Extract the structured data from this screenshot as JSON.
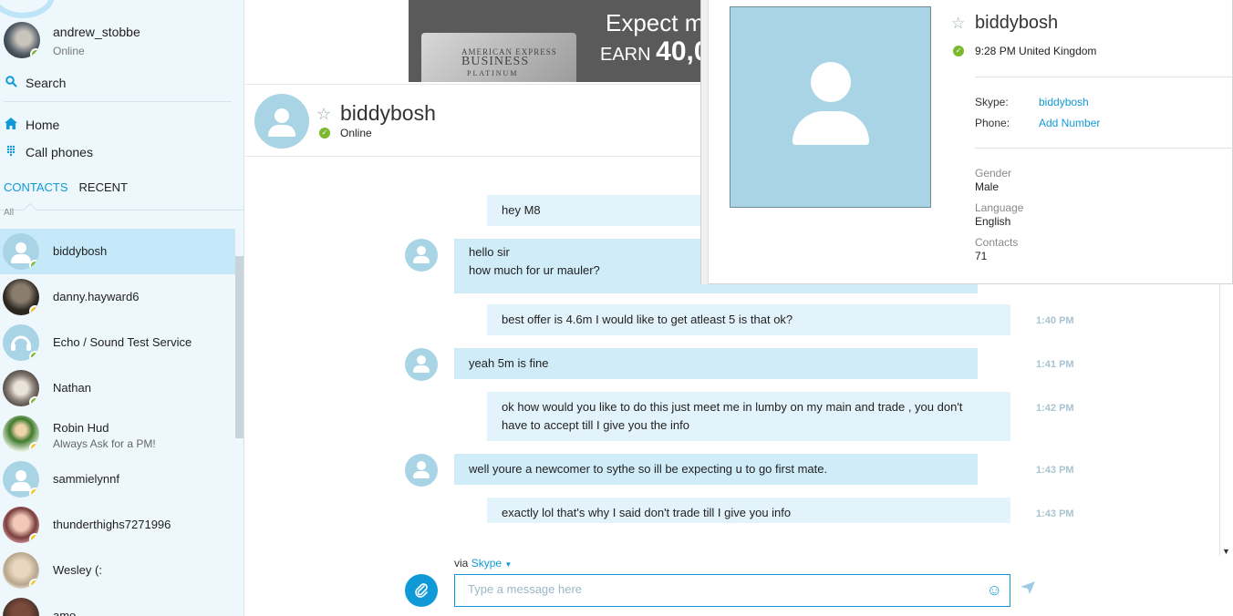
{
  "me": {
    "name": "andrew_stobbe",
    "status": "Online"
  },
  "nav": {
    "search": "Search",
    "home": "Home",
    "call_phones": "Call phones"
  },
  "tabs": {
    "contacts": "CONTACTS",
    "recent": "RECENT",
    "filter": "All"
  },
  "contacts": [
    {
      "name": "biddybosh",
      "status": "online",
      "mood": ""
    },
    {
      "name": "danny.hayward6",
      "status": "away",
      "mood": ""
    },
    {
      "name": "Echo / Sound Test Service",
      "status": "online",
      "mood": ""
    },
    {
      "name": "Nathan",
      "status": "online",
      "mood": ""
    },
    {
      "name": "Robin Hud",
      "status": "away",
      "mood": "Always Ask for a PM!"
    },
    {
      "name": "sammielynnf",
      "status": "away",
      "mood": ""
    },
    {
      "name": "thunderthighs7271996",
      "status": "away",
      "mood": ""
    },
    {
      "name": "Wesley (:",
      "status": "away",
      "mood": ""
    },
    {
      "name": "amo",
      "status": "away",
      "mood": ""
    }
  ],
  "ad": {
    "headline": "Expect m",
    "earn_prefix": "EARN",
    "earn_amount": "40,0",
    "card_brand": "AMERICAN EXPRESS",
    "card_type": "BUSINESS",
    "card_tier": "PLATINUM"
  },
  "chat": {
    "contact_name": "biddybosh",
    "contact_status": "Online",
    "messages": [
      {
        "from": "me",
        "lines": [
          "hey M8"
        ],
        "time": ""
      },
      {
        "from": "them",
        "lines": [
          "hello sir",
          "how much for ur mauler?"
        ],
        "time": ""
      },
      {
        "from": "me",
        "lines": [
          "best offer is 4.6m I would like to get atleast 5 is that ok?"
        ],
        "time": "1:40 PM"
      },
      {
        "from": "them",
        "lines": [
          "yeah 5m is fine"
        ],
        "time": "1:41 PM"
      },
      {
        "from": "me",
        "lines": [
          "ok how would you like to do this just meet me in lumby on my main and trade , you don't",
          "have to accept till I give you the info"
        ],
        "time": "1:42 PM"
      },
      {
        "from": "them",
        "lines": [
          "well youre a newcomer to sythe so ill be expecting u to go first mate."
        ],
        "time": "1:43 PM"
      },
      {
        "from": "me",
        "lines": [
          "exactly lol that's why I said don't trade till I give you info"
        ],
        "time": "1:43 PM"
      }
    ],
    "via_label": "via",
    "via_service": "Skype",
    "input_placeholder": "Type a message here"
  },
  "profile": {
    "name": "biddybosh",
    "local_time_location": "9:28 PM United Kingdom",
    "skype_label": "Skype:",
    "skype_value": "biddybosh",
    "phone_label": "Phone:",
    "phone_value": "Add Number",
    "gender_label": "Gender",
    "gender_value": "Male",
    "language_label": "Language",
    "language_value": "English",
    "contacts_label": "Contacts",
    "contacts_value": "71"
  },
  "colors": {
    "accent": "#0f9ad7",
    "online": "#7cb82f",
    "away": "#f8c21b",
    "bubble_them": "#d0ecf9",
    "bubble_me": "#e3f3fb"
  }
}
